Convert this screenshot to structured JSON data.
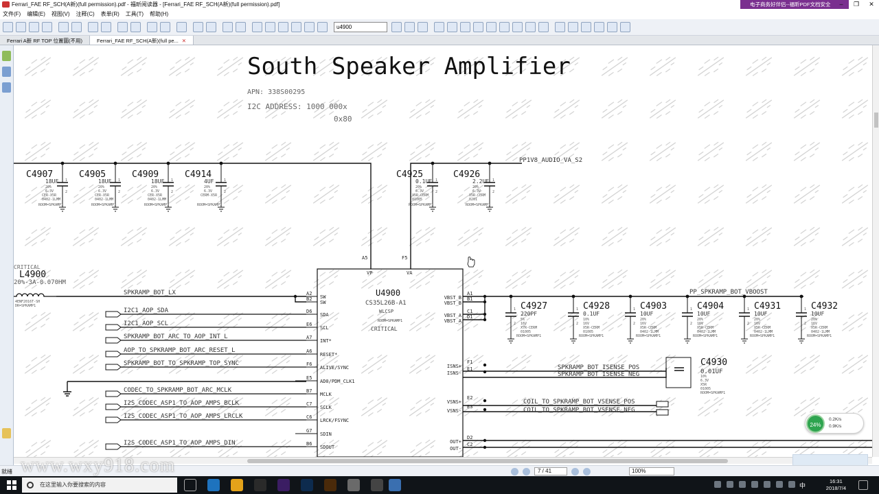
{
  "window": {
    "title": "Ferrari_FAE RF_SCH(A新)(full permission).pdf - 福昕阅读器 - [Ferrari_FAE RF_SCH(A新)(full permission).pdf]",
    "ad": "电子商务好伴侣--福昕PDF文档安全"
  },
  "menu": [
    "文件(F)",
    "编辑(E)",
    "视图(V)",
    "注释(C)",
    "表单(R)",
    "工具(T)",
    "帮助(H)"
  ],
  "toolbar": {
    "search_value": "u4900"
  },
  "tabs": [
    {
      "label": "Ferrari A新 RF TOP 位置圖(不用)",
      "active": false
    },
    {
      "label": "Ferrari_FAE RF_SCH(A新)(full pe...",
      "active": true
    }
  ],
  "schematic": {
    "title": "South Speaker Amplifier",
    "apn": "APN: 338S00295",
    "i2c": "I2C ADDRESS: 1000 000x",
    "i2c_hex": "0x80",
    "rail": "PP1V8_AUDIO_VA_S2",
    "vboost": "PP_SPKRAMP_BOT_VBOOST",
    "critical_left": "CRITICAL",
    "inductor": {
      "ref": "L4900",
      "spec": "20%-3A-0.070HM",
      "part": "4ENF2016T-SH",
      "room": "DR=SPKAMP1"
    },
    "ic": {
      "ref": "U4900",
      "part": "CS35L26B-A1",
      "pkg": "WLCSP",
      "room": "ROOM=SPKAMP1",
      "critical": "CRITICAL",
      "left_pins": [
        {
          "ball": "A2",
          "name": "SW"
        },
        {
          "ball": "B2",
          "name": "SW"
        },
        {
          "ball": "D6",
          "name": "SDA"
        },
        {
          "ball": "E6",
          "name": "SCL"
        },
        {
          "ball": "A7",
          "name": "INT*"
        },
        {
          "ball": "A6",
          "name": "RESET*"
        },
        {
          "ball": "F6",
          "name": "ALIVE/SYNC"
        },
        {
          "ball": "E5",
          "name": "AD0/PDM_CLK1"
        },
        {
          "ball": "B7",
          "name": "MCLK"
        },
        {
          "ball": "C7",
          "name": "SCLK"
        },
        {
          "ball": "C6",
          "name": "LRCK/FSYNC"
        },
        {
          "ball": "G7",
          "name": "SDIN"
        },
        {
          "ball": "B6",
          "name": "SDOUT"
        }
      ],
      "top_pins": [
        {
          "ball": "A5",
          "name": "VP"
        },
        {
          "ball": "F5",
          "name": "VA"
        }
      ],
      "right_pins": [
        {
          "ball": "A1",
          "name": "VBST_B"
        },
        {
          "ball": "B1",
          "name": "VBST_B"
        },
        {
          "ball": "C1",
          "name": "VBST_A"
        },
        {
          "ball": "D1",
          "name": "VBST_A"
        },
        {
          "ball": "F1",
          "name": "ISNS+"
        },
        {
          "ball": "E1",
          "name": "ISNS-"
        },
        {
          "ball": "E2",
          "name": "VSNS+"
        },
        {
          "ball": "E3",
          "name": "VSNS-"
        },
        {
          "ball": "D2",
          "name": "OUT+"
        },
        {
          "ball": "C2",
          "name": "OUT-"
        }
      ]
    },
    "left_nets": [
      "SPKRAMP_BOT_LX",
      "I2C1_AOP_SDA",
      "I2C1_AOP_SCL",
      "SPKRAMP_BOT_ARC_TO_AOP_INT_L",
      "AOP_TO_SPKRAMP_BOT_ARC_RESET_L",
      "SPKRAMP_BOT_TO_SPKRAMP_TOP_SYNC",
      "CODEC_TO_SPKRAMP_BOT_ARC_MCLK",
      "I2S_CODEC_ASP1_TO_AOP_AMPS_BCLK",
      "I2S_CODEC_ASP1_TO_AOP_AMPS_LRCLK",
      "I2S_CODEC_ASP1_TO_AOP_AMPS_DIN"
    ],
    "right_nets": [
      "SPKRAMP_BOT_ISENSE_POS",
      "SPKRAMP_BOT_ISENSE_NEG",
      "COIL_TO_SPKRAMP_BOT_VSENSE_POS",
      "COIL_TO_SPKRAMP_BOT_VSENSE_NEG"
    ],
    "caps_top_left": [
      {
        "ref": "C4907",
        "value": "18UF",
        "tol": "20%",
        "v": "6.3V",
        "diel": "CER-X5R",
        "pkg": "0402-1LMM",
        "room": "ROOM=SPKAMP1"
      },
      {
        "ref": "C4905",
        "value": "18UF",
        "tol": "20%",
        "v": "6.3V",
        "diel": "CER-X5R",
        "pkg": "0402-1LMM",
        "room": "ROOM=SPKAMP1"
      },
      {
        "ref": "C4909",
        "value": "18UF",
        "tol": "20%",
        "v": "6.3V",
        "diel": "CER-X5R",
        "pkg": "0402-1LMM",
        "room": "ROOM=SPKAMP1"
      },
      {
        "ref": "C4914",
        "value": "4UF",
        "tol": "20%",
        "v": "6.3V",
        "diel": "CERM-X5R",
        "pkg": "",
        "room": "ROOM=SPKAMP1"
      }
    ],
    "caps_top_right": [
      {
        "ref": "C4925",
        "value": "0.1UF",
        "tol": "20%",
        "v": "6.3V",
        "diel": "X5R-CERM",
        "pkg": "01005",
        "room": "ROOM=SPKAMP1"
      },
      {
        "ref": "C4926",
        "value": "2.2UF",
        "tol": "20%",
        "v": "6.3V",
        "diel": "X5R-CERM",
        "pkg": "0201",
        "room": "ROOM=SPKAMP1"
      }
    ],
    "caps_right": [
      {
        "ref": "C4927",
        "value": "220PF",
        "tol": "5%",
        "v": "16V",
        "diel": "X7R-CERM",
        "pkg": "01005",
        "room": "ROOM=SPKAMP1"
      },
      {
        "ref": "C4928",
        "value": "0.1UF",
        "tol": "10%",
        "v": "16V",
        "diel": "X5R-CERM",
        "pkg": "01005",
        "room": "ROOM=SPKAMP1"
      },
      {
        "ref": "C4903",
        "value": "10UF",
        "tol": "20%",
        "v": "16V",
        "diel": "X5R-CERM",
        "pkg": "0402-1LMM",
        "room": "ROOM=SPKAMP1"
      },
      {
        "ref": "C4904",
        "value": "10UF",
        "tol": "20%",
        "v": "16V",
        "diel": "X5R-CERM",
        "pkg": "0402-1LMM",
        "room": "ROOM=SPKAMP1"
      },
      {
        "ref": "C4931",
        "value": "10UF",
        "tol": "20%",
        "v": "16V",
        "diel": "X5R-CERM",
        "pkg": "0402-1LMM",
        "room": "ROOM=SPKAMP1"
      },
      {
        "ref": "C4932",
        "value": "10UF",
        "tol": "20%",
        "v": "16V",
        "diel": "X5R-CERM",
        "pkg": "0402-1LMM",
        "room": "ROOM=SPKAMP1"
      }
    ],
    "c4930": {
      "ref": "C4930",
      "value": "0.01UF",
      "tol": "10%",
      "v": "6.3V",
      "diel": "X5R",
      "pkg": "01005",
      "room": "ROOM=SPKAMP1"
    }
  },
  "status": {
    "left": "就绪",
    "page": "7 / 41",
    "zoom": "100%"
  },
  "netwidget": {
    "percent": "24%",
    "up": "0.2K/s",
    "down": "0.9K/s"
  },
  "taskbar": {
    "search_placeholder": "在这里输入你要搜索的内容",
    "time": "16:31",
    "date": "2018/7/4",
    "ime": "中"
  },
  "watermark": "www.wxy918.com"
}
